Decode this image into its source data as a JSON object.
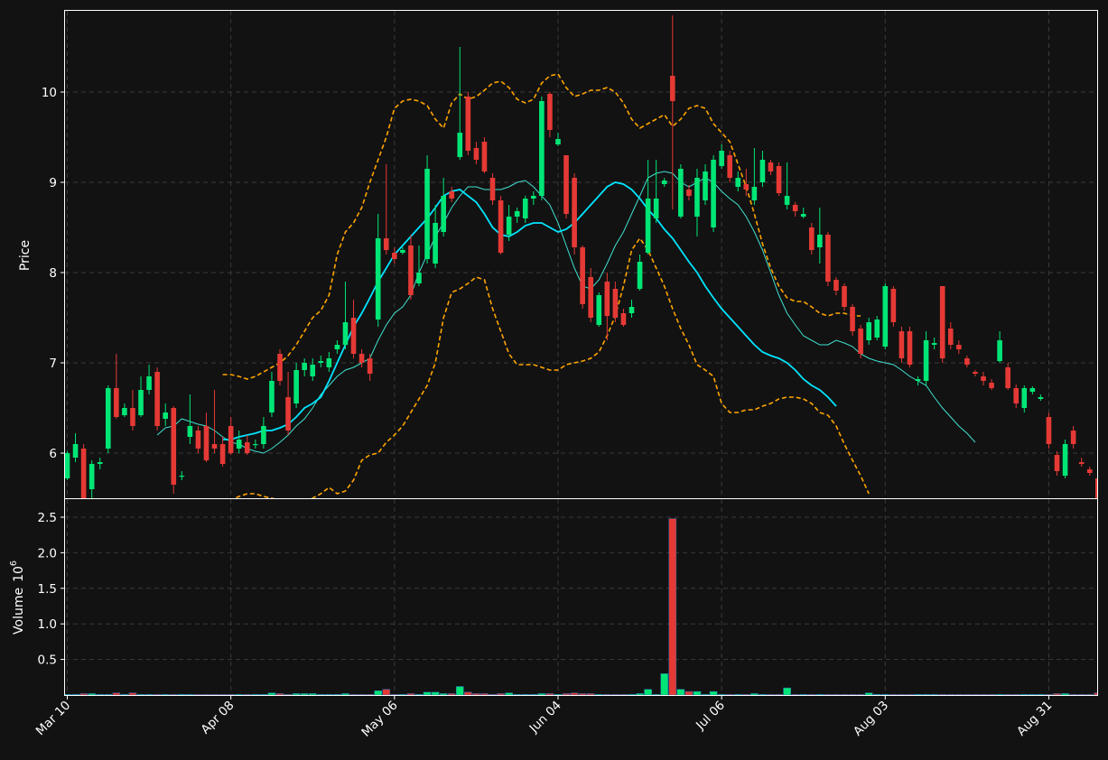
{
  "colors": {
    "background": "#121212",
    "up": "#00e676",
    "down": "#e53935",
    "ma_fast": "#40e0d0",
    "ma_slow": "#00e5ff",
    "bollinger": "#ffa500",
    "grid": "#3a3a3a",
    "axis": "#ffffff"
  },
  "chart_data": {
    "type": "candlestick",
    "grid": true,
    "price_panel": {
      "ylabel": "Price",
      "ylim": [
        5.5,
        10.9
      ],
      "yticks": [
        6,
        7,
        8,
        9,
        10
      ]
    },
    "volume_panel": {
      "ylabel": "Volume",
      "scale_label": "10",
      "scale_exponent": "6",
      "ylim": [
        0,
        2.5
      ],
      "yticks": [
        0.5,
        1.0,
        1.5,
        2.0,
        2.5
      ],
      "ytick_labels": [
        "0.5",
        "1.0",
        "1.5",
        "2.0",
        "2.5"
      ]
    },
    "x_ticks": [
      {
        "index": 0,
        "label": "Mar 10"
      },
      {
        "index": 20,
        "label": "Apr 08"
      },
      {
        "index": 40,
        "label": "May 06"
      },
      {
        "index": 60,
        "label": "Jun 04"
      },
      {
        "index": 80,
        "label": "Jul 06"
      },
      {
        "index": 100,
        "label": "Aug 03"
      },
      {
        "index": 120,
        "label": "Aug 31"
      }
    ],
    "candles": [
      [
        5.72,
        6.0,
        5.7,
        6.02,
        0.01
      ],
      [
        5.95,
        6.1,
        5.9,
        6.22,
        0.01
      ],
      [
        6.05,
        5.5,
        5.5,
        6.1,
        0.02
      ],
      [
        5.6,
        5.88,
        5.5,
        5.92,
        0.02
      ],
      [
        5.88,
        5.9,
        5.82,
        5.95,
        0.01
      ],
      [
        6.05,
        6.72,
        6.0,
        6.75,
        0.01
      ],
      [
        6.72,
        6.4,
        6.38,
        7.1,
        0.03
      ],
      [
        6.42,
        6.5,
        6.4,
        6.55,
        0.01
      ],
      [
        6.5,
        6.3,
        6.25,
        6.7,
        0.03
      ],
      [
        6.42,
        6.7,
        6.4,
        6.85,
        0.01
      ],
      [
        6.7,
        6.85,
        6.65,
        6.98,
        0.01
      ],
      [
        6.9,
        6.3,
        6.25,
        6.95,
        0.01
      ],
      [
        6.38,
        6.45,
        6.3,
        6.55,
        0.01
      ],
      [
        6.5,
        5.65,
        5.55,
        6.52,
        0.01
      ],
      [
        5.75,
        5.75,
        5.7,
        5.8,
        0.01
      ],
      [
        6.18,
        6.3,
        6.1,
        6.65,
        0.01
      ],
      [
        6.25,
        6.05,
        6.0,
        6.3,
        0.01
      ],
      [
        6.3,
        5.92,
        5.9,
        6.45,
        0.01
      ],
      [
        6.1,
        6.05,
        6.0,
        6.7,
        0.01
      ],
      [
        6.1,
        5.88,
        5.85,
        6.18,
        0.01
      ],
      [
        6.3,
        6.0,
        5.98,
        6.4,
        0.01
      ],
      [
        6.05,
        6.15,
        6.0,
        6.25,
        0.01
      ],
      [
        6.12,
        6.0,
        5.98,
        6.2,
        0.01
      ],
      [
        6.1,
        6.1,
        6.05,
        6.15,
        0.01
      ],
      [
        6.1,
        6.3,
        6.05,
        6.4,
        0.01
      ],
      [
        6.45,
        6.8,
        6.4,
        6.9,
        0.03
      ],
      [
        7.1,
        6.8,
        6.75,
        7.15,
        0.02
      ],
      [
        6.62,
        6.25,
        6.2,
        6.9,
        0.01
      ],
      [
        6.55,
        6.92,
        6.5,
        7.0,
        0.02
      ],
      [
        6.92,
        7.0,
        6.85,
        7.05,
        0.02
      ],
      [
        6.85,
        6.98,
        6.8,
        7.05,
        0.02
      ],
      [
        7.0,
        7.02,
        6.95,
        7.08,
        0.01
      ],
      [
        6.95,
        7.05,
        6.9,
        7.12,
        0.01
      ],
      [
        7.15,
        7.2,
        7.1,
        7.25,
        0.01
      ],
      [
        7.2,
        7.45,
        7.15,
        7.9,
        0.02
      ],
      [
        7.5,
        7.1,
        7.05,
        7.7,
        0.01
      ],
      [
        7.1,
        7.0,
        6.95,
        7.15,
        0.01
      ],
      [
        7.05,
        6.88,
        6.8,
        7.1,
        0.01
      ],
      [
        7.48,
        8.38,
        7.4,
        8.65,
        0.06
      ],
      [
        8.38,
        8.25,
        8.2,
        9.2,
        0.08
      ],
      [
        8.22,
        8.15,
        8.1,
        8.28,
        0.01
      ],
      [
        8.22,
        8.25,
        8.2,
        8.28,
        0.01
      ],
      [
        8.3,
        7.75,
        7.7,
        8.42,
        0.02
      ],
      [
        7.88,
        8.0,
        7.85,
        8.3,
        0.01
      ],
      [
        8.15,
        9.15,
        8.1,
        9.3,
        0.04
      ],
      [
        8.1,
        8.55,
        8.05,
        8.75,
        0.04
      ],
      [
        8.45,
        8.85,
        8.4,
        9.05,
        0.02
      ],
      [
        8.9,
        8.82,
        8.78,
        8.95,
        0.02
      ],
      [
        9.28,
        9.55,
        9.25,
        10.5,
        0.12
      ],
      [
        9.95,
        9.35,
        9.3,
        10.0,
        0.04
      ],
      [
        9.38,
        9.25,
        9.2,
        9.45,
        0.02
      ],
      [
        9.45,
        9.12,
        9.1,
        9.5,
        0.02
      ],
      [
        9.05,
        8.8,
        8.75,
        9.1,
        0.01
      ],
      [
        8.8,
        8.22,
        8.2,
        8.85,
        0.02
      ],
      [
        8.42,
        8.62,
        8.35,
        8.75,
        0.03
      ],
      [
        8.62,
        8.68,
        8.55,
        8.72,
        0.01
      ],
      [
        8.6,
        8.82,
        8.55,
        8.85,
        0.01
      ],
      [
        8.82,
        8.85,
        8.75,
        8.9,
        0.01
      ],
      [
        8.85,
        9.9,
        8.8,
        9.95,
        0.02
      ],
      [
        9.98,
        9.58,
        9.5,
        10.0,
        0.02
      ],
      [
        9.42,
        9.48,
        9.4,
        9.55,
        0.01
      ],
      [
        9.3,
        8.65,
        8.6,
        9.3,
        0.02
      ],
      [
        9.05,
        8.28,
        8.2,
        9.1,
        0.03
      ],
      [
        8.28,
        7.65,
        7.6,
        8.3,
        0.02
      ],
      [
        7.95,
        7.5,
        7.45,
        8.05,
        0.02
      ],
      [
        7.42,
        7.75,
        7.4,
        7.78,
        0.01
      ],
      [
        7.9,
        7.52,
        7.25,
        8.0,
        0.01
      ],
      [
        7.82,
        7.5,
        7.45,
        7.9,
        0.01
      ],
      [
        7.55,
        7.42,
        7.4,
        7.6,
        0.01
      ],
      [
        7.55,
        7.62,
        7.5,
        7.7,
        0.01
      ],
      [
        7.82,
        8.12,
        7.8,
        8.2,
        0.02
      ],
      [
        8.22,
        8.82,
        8.2,
        9.25,
        0.08
      ],
      [
        8.6,
        8.82,
        8.55,
        9.25,
        0.01
      ],
      [
        8.98,
        9.02,
        8.95,
        9.05,
        0.3
      ],
      [
        10.18,
        9.9,
        8.7,
        10.85,
        2.48
      ],
      [
        8.62,
        9.15,
        8.6,
        9.2,
        0.08
      ],
      [
        8.92,
        8.85,
        8.8,
        8.97,
        0.05
      ],
      [
        8.62,
        9.05,
        8.4,
        9.15,
        0.05
      ],
      [
        8.8,
        9.12,
        8.75,
        9.2,
        0.01
      ],
      [
        8.5,
        9.25,
        8.45,
        9.3,
        0.05
      ],
      [
        9.18,
        9.35,
        9.15,
        9.42,
        0.01
      ],
      [
        9.3,
        9.05,
        9.0,
        9.35,
        0.01
      ],
      [
        8.95,
        9.05,
        8.9,
        9.12,
        0.01
      ],
      [
        8.98,
        8.92,
        8.85,
        9.15,
        0.01
      ],
      [
        8.8,
        8.95,
        8.75,
        9.38,
        0.02
      ],
      [
        9.0,
        9.25,
        8.95,
        9.35,
        0.01
      ],
      [
        9.22,
        9.12,
        9.08,
        9.25,
        0.01
      ],
      [
        9.18,
        8.88,
        8.85,
        9.22,
        0.01
      ],
      [
        8.75,
        8.85,
        8.7,
        9.22,
        0.1
      ],
      [
        8.75,
        8.68,
        8.62,
        8.78,
        0.01
      ],
      [
        8.62,
        8.65,
        8.6,
        8.72,
        0.01
      ],
      [
        8.5,
        8.25,
        8.2,
        8.55,
        0.01
      ],
      [
        8.28,
        8.42,
        8.1,
        8.72,
        0.01
      ],
      [
        8.42,
        7.9,
        7.85,
        8.45,
        0.01
      ],
      [
        7.92,
        7.8,
        7.75,
        7.95,
        0.01
      ],
      [
        7.85,
        7.62,
        7.58,
        7.88,
        0.01
      ],
      [
        7.62,
        7.35,
        7.3,
        7.65,
        0.01
      ],
      [
        7.38,
        7.1,
        7.05,
        7.42,
        0.01
      ],
      [
        7.25,
        7.45,
        7.2,
        7.5,
        0.03
      ],
      [
        7.28,
        7.48,
        7.25,
        7.52,
        0.01
      ],
      [
        7.18,
        7.85,
        7.15,
        7.88,
        0.01
      ],
      [
        7.82,
        7.45,
        7.4,
        7.85,
        0.01
      ],
      [
        7.35,
        7.05,
        7.0,
        7.4,
        0.01
      ],
      [
        7.35,
        6.98,
        6.95,
        7.4,
        0.01
      ],
      [
        6.8,
        6.82,
        6.75,
        6.85,
        0.01
      ],
      [
        6.8,
        7.25,
        6.75,
        7.35,
        0.01
      ],
      [
        7.2,
        7.22,
        7.15,
        7.28,
        0.01
      ],
      [
        7.85,
        7.05,
        7.0,
        7.85,
        0.01
      ],
      [
        7.38,
        7.2,
        7.15,
        7.45,
        0.01
      ],
      [
        7.2,
        7.15,
        7.1,
        7.25,
        0.01
      ],
      [
        7.05,
        6.98,
        6.95,
        7.08,
        0.01
      ],
      [
        6.9,
        6.88,
        6.85,
        6.92,
        0.01
      ],
      [
        6.85,
        6.8,
        6.75,
        6.9,
        0.01
      ],
      [
        6.78,
        6.72,
        6.7,
        6.82,
        0.01
      ],
      [
        7.02,
        7.25,
        7.0,
        7.35,
        0.01
      ],
      [
        6.95,
        6.72,
        6.7,
        7.0,
        0.01
      ],
      [
        6.72,
        6.55,
        6.5,
        6.76,
        0.01
      ],
      [
        6.5,
        6.72,
        6.45,
        6.75,
        0.01
      ],
      [
        6.68,
        6.72,
        6.65,
        6.74,
        0.01
      ],
      [
        6.6,
        6.62,
        6.58,
        6.65,
        0.01
      ],
      [
        6.4,
        6.1,
        6.05,
        6.45,
        0.01
      ],
      [
        5.98,
        5.8,
        5.75,
        6.02,
        0.02
      ],
      [
        5.75,
        6.1,
        5.72,
        6.15,
        0.02
      ],
      [
        6.25,
        6.1,
        6.05,
        6.3,
        0.01
      ],
      [
        5.9,
        5.88,
        5.85,
        5.95,
        0.01
      ],
      [
        5.82,
        5.78,
        5.75,
        5.85,
        0.01
      ],
      [
        5.72,
        5.5,
        5.45,
        5.75,
        0.03
      ]
    ],
    "series": [
      {
        "name": "",
        "style": "ma_fast",
        "start": 11,
        "values": [
          6.2,
          6.28,
          6.3,
          6.38,
          6.35,
          6.32,
          6.3,
          6.25,
          6.18,
          6.12,
          6.1,
          6.05,
          6.02,
          6.0,
          6.05,
          6.12,
          6.2,
          6.3,
          6.38,
          6.5,
          6.65,
          6.75,
          6.85,
          6.92,
          6.95,
          7.0,
          7.05,
          7.25,
          7.42,
          7.55,
          7.62,
          7.75,
          8.0,
          8.2,
          8.4,
          8.55,
          8.72,
          8.85,
          8.95,
          8.95,
          8.92,
          8.92,
          8.92,
          8.95,
          9.0,
          9.02,
          8.95,
          8.85,
          8.75,
          8.55,
          8.3,
          8.05,
          7.85,
          7.82,
          7.92,
          8.1,
          8.3,
          8.45,
          8.65,
          8.85,
          9.05,
          9.1,
          9.12,
          9.1,
          9.0,
          8.95,
          9.0,
          9.05,
          9.0,
          8.9,
          8.82,
          8.75,
          8.62,
          8.45,
          8.25,
          8.0,
          7.75,
          7.55,
          7.42,
          7.3,
          7.25,
          7.2,
          7.2,
          7.25,
          7.22,
          7.18,
          7.1,
          7.05,
          7.02,
          7.0,
          6.98,
          6.92,
          6.85,
          6.8,
          6.75,
          6.62,
          6.5,
          6.4,
          6.3,
          6.22,
          6.12
        ]
      },
      {
        "name": "",
        "style": "ma_slow",
        "start": 19,
        "values": [
          6.15,
          6.15,
          6.18,
          6.2,
          6.22,
          6.25,
          6.25,
          6.28,
          6.32,
          6.4,
          6.5,
          6.55,
          6.62,
          6.8,
          7.0,
          7.2,
          7.4,
          7.55,
          7.72,
          7.9,
          8.05,
          8.2,
          8.3,
          8.4,
          8.5,
          8.6,
          8.72,
          8.85,
          8.9,
          8.92,
          8.85,
          8.78,
          8.65,
          8.5,
          8.42,
          8.4,
          8.45,
          8.52,
          8.55,
          8.55,
          8.5,
          8.45,
          8.48,
          8.55,
          8.65,
          8.75,
          8.85,
          8.95,
          9.0,
          8.98,
          8.92,
          8.82,
          8.7,
          8.6,
          8.48,
          8.38,
          8.25,
          8.12,
          8.0,
          7.85,
          7.72,
          7.6,
          7.5,
          7.4,
          7.3,
          7.2,
          7.12,
          7.08,
          7.05,
          7.0,
          6.92,
          6.82,
          6.75,
          6.7,
          6.62,
          6.52
        ]
      },
      {
        "name": "",
        "style": "bollinger",
        "start": 19,
        "values": [
          6.87,
          6.87,
          6.85,
          6.82,
          6.85,
          6.9,
          6.95,
          7.0,
          7.08,
          7.2,
          7.35,
          7.5,
          7.58,
          7.75,
          8.2,
          8.45,
          8.55,
          8.72,
          9.0,
          9.25,
          9.5,
          9.82,
          9.9,
          9.92,
          9.9,
          9.85,
          9.7,
          9.6,
          9.88,
          9.98,
          9.92,
          9.95,
          10.02,
          10.1,
          10.12,
          10.05,
          9.92,
          9.88,
          9.92,
          10.1,
          10.18,
          10.2,
          10.05,
          9.95,
          9.98,
          10.02,
          10.02,
          10.05,
          10.0,
          9.88,
          9.7,
          9.6,
          9.65,
          9.7,
          9.75,
          9.62,
          9.7,
          9.82,
          9.85,
          9.82,
          9.65,
          9.55,
          9.45,
          9.2,
          8.95,
          8.65,
          8.32,
          8.05,
          7.85,
          7.72,
          7.68,
          7.68,
          7.62,
          7.55,
          7.52,
          7.55,
          7.55,
          7.52,
          7.52
        ]
      },
      {
        "name": "",
        "style": "bollinger",
        "start": 19,
        "values": [
          5.45,
          5.48,
          5.52,
          5.55,
          5.55,
          5.52,
          5.5,
          5.48,
          5.45,
          5.42,
          5.45,
          5.5,
          5.55,
          5.62,
          5.55,
          5.58,
          5.7,
          5.92,
          5.98,
          6.0,
          6.12,
          6.2,
          6.3,
          6.45,
          6.6,
          6.75,
          7.0,
          7.5,
          7.78,
          7.82,
          7.88,
          7.95,
          7.92,
          7.6,
          7.35,
          7.1,
          6.98,
          6.98,
          6.98,
          6.95,
          6.92,
          6.92,
          6.98,
          7.0,
          7.02,
          7.05,
          7.12,
          7.3,
          7.52,
          7.85,
          8.25,
          8.38,
          8.25,
          8.05,
          7.85,
          7.6,
          7.38,
          7.2,
          6.98,
          6.92,
          6.85,
          6.55,
          6.45,
          6.45,
          6.48,
          6.48,
          6.52,
          6.55,
          6.6,
          6.62,
          6.62,
          6.6,
          6.55,
          6.45,
          6.42,
          6.3,
          6.1,
          5.92,
          5.75,
          5.55
        ]
      }
    ]
  }
}
